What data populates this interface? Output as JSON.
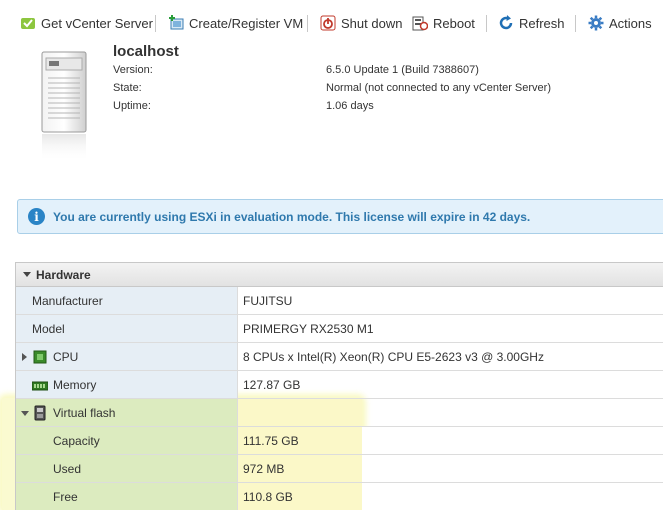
{
  "toolbar": {
    "items": [
      {
        "label": "Get vCenter Server",
        "icon": "vcenter-icon"
      },
      {
        "label": "Create/Register VM",
        "icon": "create-vm-icon"
      },
      {
        "label": "Shut down",
        "icon": "shutdown-icon"
      },
      {
        "label": "Reboot",
        "icon": "reboot-icon"
      },
      {
        "label": "Refresh",
        "icon": "refresh-icon"
      },
      {
        "label": "Actions",
        "icon": "gear-icon"
      }
    ]
  },
  "host": {
    "name": "localhost",
    "fields": [
      {
        "label": "Version:",
        "value": "6.5.0 Update 1 (Build 7388607)"
      },
      {
        "label": "State:",
        "value": "Normal (not connected to any vCenter Server)"
      },
      {
        "label": "Uptime:",
        "value": "1.06 days"
      }
    ]
  },
  "banner": {
    "icon": "info-icon",
    "message": "You are currently using ESXi in evaluation mode. This license will expire in 42 days."
  },
  "hardware": {
    "title": "Hardware",
    "rows": [
      {
        "label": "Manufacturer",
        "value": "FUJITSU"
      },
      {
        "label": "Model",
        "value": "PRIMERGY RX2530 M1"
      },
      {
        "label": "CPU",
        "value": "8 CPUs x Intel(R) Xeon(R) CPU E5-2623 v3 @ 3.00GHz",
        "icon": "cpu-icon",
        "expandable": "collapsed"
      },
      {
        "label": "Memory",
        "value": "127.87 GB",
        "icon": "memory-icon"
      },
      {
        "label": "Virtual flash",
        "value": "",
        "icon": "flash-icon",
        "expandable": "expanded"
      },
      {
        "label": "Capacity",
        "value": "111.75 GB"
      },
      {
        "label": "Used",
        "value": "972 MB"
      },
      {
        "label": "Free",
        "value": "110.8 GB"
      }
    ]
  },
  "colors": {
    "accent": "#2a84c6",
    "banner_bg": "#e3f1fb",
    "label_col_bg": "#e6eef5",
    "highlight_left": "#dcebbf",
    "highlight_right": "#fbf8c8"
  }
}
